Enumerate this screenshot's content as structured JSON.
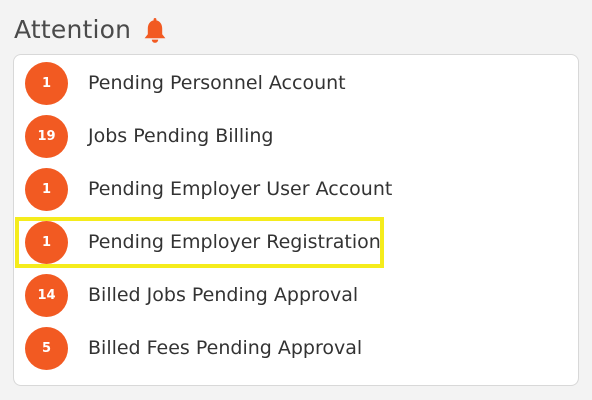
{
  "header": {
    "title": "Attention",
    "icon": "bell-icon",
    "icon_color": "#f25a22"
  },
  "colors": {
    "badge": "#f25a22",
    "highlight": "#f5ec1c"
  },
  "items": [
    {
      "count": "1",
      "label": "Pending Personnel Account",
      "highlighted": false
    },
    {
      "count": "19",
      "label": "Jobs Pending Billing",
      "highlighted": false
    },
    {
      "count": "1",
      "label": "Pending Employer User Account",
      "highlighted": false
    },
    {
      "count": "1",
      "label": "Pending Employer Registration",
      "highlighted": true
    },
    {
      "count": "14",
      "label": "Billed Jobs Pending Approval",
      "highlighted": false
    },
    {
      "count": "5",
      "label": "Billed Fees Pending Approval",
      "highlighted": false
    }
  ]
}
